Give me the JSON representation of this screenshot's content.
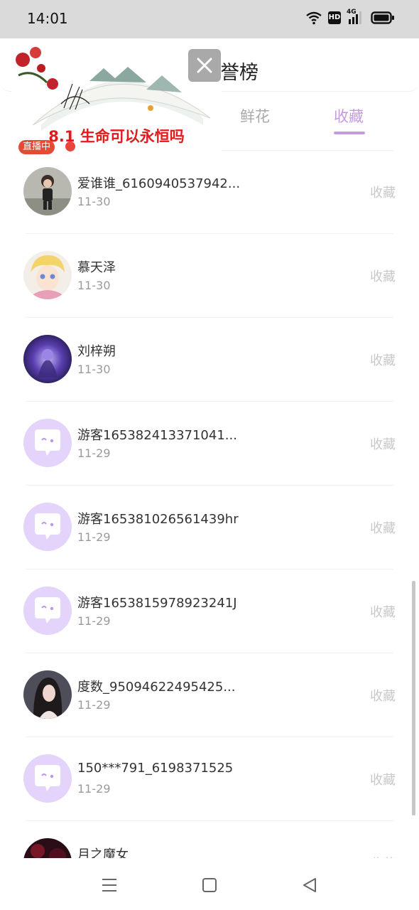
{
  "status_bar": {
    "time": "14:01",
    "hd": "HD",
    "network": "4G"
  },
  "header": {
    "title_partial": "誉榜"
  },
  "tabs": [
    {
      "label": "鲜花",
      "active": false
    },
    {
      "label": "收藏",
      "active": true
    }
  ],
  "colors": {
    "accent": "#c59be0",
    "guest_avatar": "#e4d4fb",
    "live_red": "#e41a1a"
  },
  "list": [
    {
      "name": "爱谁谁_6160940537942...",
      "date": "11-30",
      "action": "收藏",
      "avatar": "photo-child"
    },
    {
      "name": "慕天泽",
      "date": "11-30",
      "action": "收藏",
      "avatar": "anime-blonde"
    },
    {
      "name": "刘梓朔",
      "date": "11-30",
      "action": "收藏",
      "avatar": "dark-purple-hero"
    },
    {
      "name": "游客165382413371041...",
      "date": "11-29",
      "action": "收藏",
      "avatar": "guest-chat-icon"
    },
    {
      "name": "游客165381026561439hr",
      "date": "11-29",
      "action": "收藏",
      "avatar": "guest-chat-icon"
    },
    {
      "name": "游客1653815978923241J",
      "date": "11-29",
      "action": "收藏",
      "avatar": "guest-chat-icon"
    },
    {
      "name": "度数_95094622495425...",
      "date": "11-29",
      "action": "收藏",
      "avatar": "photo-girl"
    },
    {
      "name": "150***791_6198371525",
      "date": "11-29",
      "action": "收藏",
      "avatar": "guest-chat-icon"
    },
    {
      "name": "月之魔女",
      "date": "",
      "action": "收藏",
      "avatar": "photo-dark-red"
    }
  ],
  "overlay": {
    "title": "8.1  生命可以永恒吗",
    "live_label": "直播中"
  },
  "nav": {
    "items": [
      "menu-icon",
      "home-icon",
      "back-icon"
    ]
  }
}
